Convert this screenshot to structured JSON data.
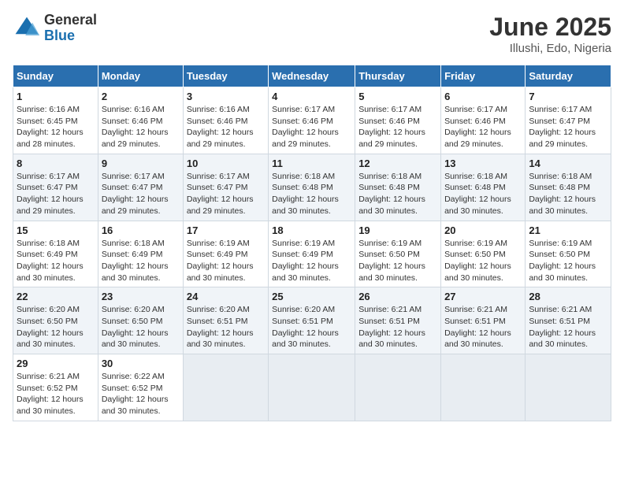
{
  "logo": {
    "general": "General",
    "blue": "Blue"
  },
  "title": {
    "month": "June 2025",
    "location": "Illushi, Edo, Nigeria"
  },
  "weekdays": [
    "Sunday",
    "Monday",
    "Tuesday",
    "Wednesday",
    "Thursday",
    "Friday",
    "Saturday"
  ],
  "weeks": [
    [
      {
        "day": "1",
        "sunrise": "6:16 AM",
        "sunset": "6:45 PM",
        "daylight": "12 hours and 28 minutes."
      },
      {
        "day": "2",
        "sunrise": "6:16 AM",
        "sunset": "6:46 PM",
        "daylight": "12 hours and 29 minutes."
      },
      {
        "day": "3",
        "sunrise": "6:16 AM",
        "sunset": "6:46 PM",
        "daylight": "12 hours and 29 minutes."
      },
      {
        "day": "4",
        "sunrise": "6:17 AM",
        "sunset": "6:46 PM",
        "daylight": "12 hours and 29 minutes."
      },
      {
        "day": "5",
        "sunrise": "6:17 AM",
        "sunset": "6:46 PM",
        "daylight": "12 hours and 29 minutes."
      },
      {
        "day": "6",
        "sunrise": "6:17 AM",
        "sunset": "6:46 PM",
        "daylight": "12 hours and 29 minutes."
      },
      {
        "day": "7",
        "sunrise": "6:17 AM",
        "sunset": "6:47 PM",
        "daylight": "12 hours and 29 minutes."
      }
    ],
    [
      {
        "day": "8",
        "sunrise": "6:17 AM",
        "sunset": "6:47 PM",
        "daylight": "12 hours and 29 minutes."
      },
      {
        "day": "9",
        "sunrise": "6:17 AM",
        "sunset": "6:47 PM",
        "daylight": "12 hours and 29 minutes."
      },
      {
        "day": "10",
        "sunrise": "6:17 AM",
        "sunset": "6:47 PM",
        "daylight": "12 hours and 29 minutes."
      },
      {
        "day": "11",
        "sunrise": "6:18 AM",
        "sunset": "6:48 PM",
        "daylight": "12 hours and 30 minutes."
      },
      {
        "day": "12",
        "sunrise": "6:18 AM",
        "sunset": "6:48 PM",
        "daylight": "12 hours and 30 minutes."
      },
      {
        "day": "13",
        "sunrise": "6:18 AM",
        "sunset": "6:48 PM",
        "daylight": "12 hours and 30 minutes."
      },
      {
        "day": "14",
        "sunrise": "6:18 AM",
        "sunset": "6:48 PM",
        "daylight": "12 hours and 30 minutes."
      }
    ],
    [
      {
        "day": "15",
        "sunrise": "6:18 AM",
        "sunset": "6:49 PM",
        "daylight": "12 hours and 30 minutes."
      },
      {
        "day": "16",
        "sunrise": "6:18 AM",
        "sunset": "6:49 PM",
        "daylight": "12 hours and 30 minutes."
      },
      {
        "day": "17",
        "sunrise": "6:19 AM",
        "sunset": "6:49 PM",
        "daylight": "12 hours and 30 minutes."
      },
      {
        "day": "18",
        "sunrise": "6:19 AM",
        "sunset": "6:49 PM",
        "daylight": "12 hours and 30 minutes."
      },
      {
        "day": "19",
        "sunrise": "6:19 AM",
        "sunset": "6:50 PM",
        "daylight": "12 hours and 30 minutes."
      },
      {
        "day": "20",
        "sunrise": "6:19 AM",
        "sunset": "6:50 PM",
        "daylight": "12 hours and 30 minutes."
      },
      {
        "day": "21",
        "sunrise": "6:19 AM",
        "sunset": "6:50 PM",
        "daylight": "12 hours and 30 minutes."
      }
    ],
    [
      {
        "day": "22",
        "sunrise": "6:20 AM",
        "sunset": "6:50 PM",
        "daylight": "12 hours and 30 minutes."
      },
      {
        "day": "23",
        "sunrise": "6:20 AM",
        "sunset": "6:50 PM",
        "daylight": "12 hours and 30 minutes."
      },
      {
        "day": "24",
        "sunrise": "6:20 AM",
        "sunset": "6:51 PM",
        "daylight": "12 hours and 30 minutes."
      },
      {
        "day": "25",
        "sunrise": "6:20 AM",
        "sunset": "6:51 PM",
        "daylight": "12 hours and 30 minutes."
      },
      {
        "day": "26",
        "sunrise": "6:21 AM",
        "sunset": "6:51 PM",
        "daylight": "12 hours and 30 minutes."
      },
      {
        "day": "27",
        "sunrise": "6:21 AM",
        "sunset": "6:51 PM",
        "daylight": "12 hours and 30 minutes."
      },
      {
        "day": "28",
        "sunrise": "6:21 AM",
        "sunset": "6:51 PM",
        "daylight": "12 hours and 30 minutes."
      }
    ],
    [
      {
        "day": "29",
        "sunrise": "6:21 AM",
        "sunset": "6:52 PM",
        "daylight": "12 hours and 30 minutes."
      },
      {
        "day": "30",
        "sunrise": "6:22 AM",
        "sunset": "6:52 PM",
        "daylight": "12 hours and 30 minutes."
      },
      null,
      null,
      null,
      null,
      null
    ]
  ],
  "labels": {
    "sunrise": "Sunrise:",
    "sunset": "Sunset:",
    "daylight": "Daylight:"
  }
}
